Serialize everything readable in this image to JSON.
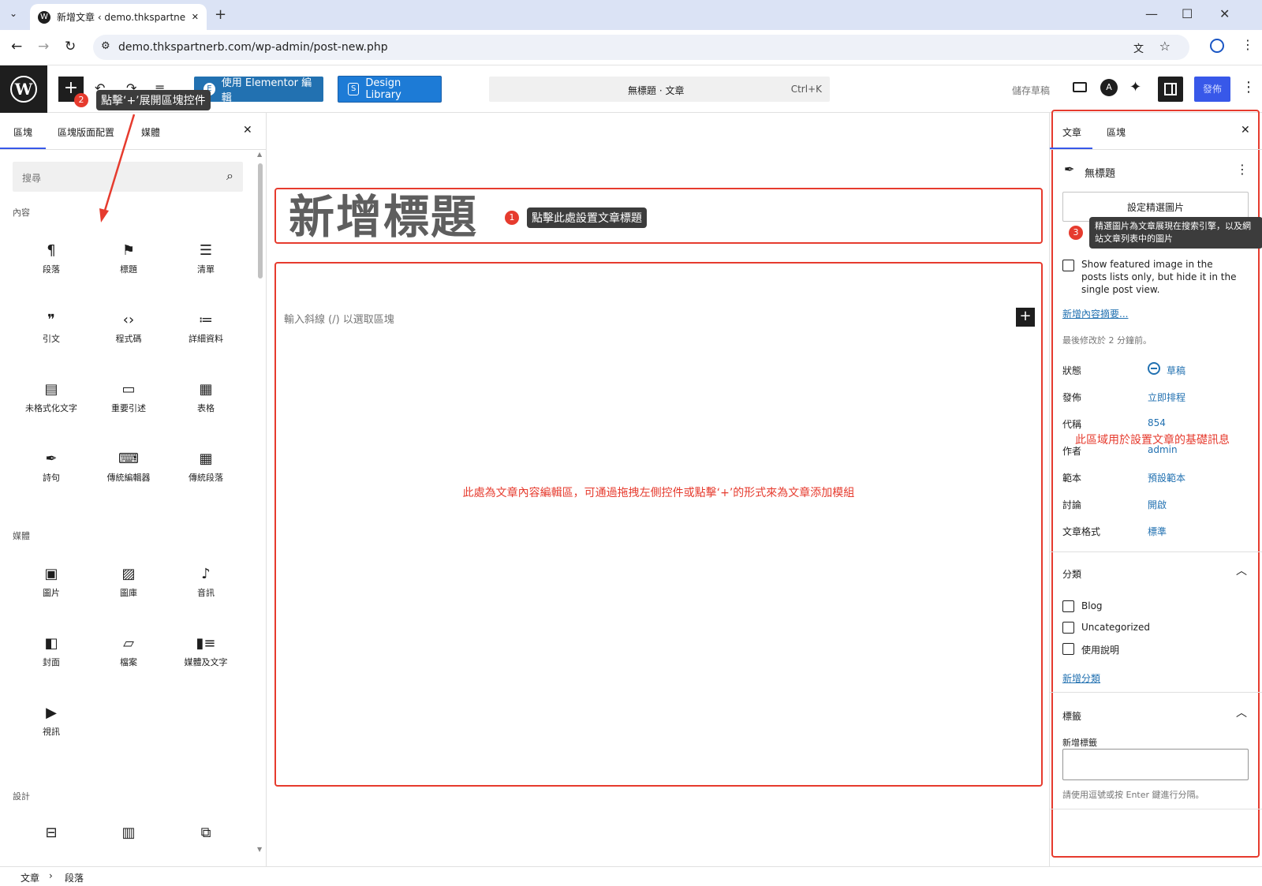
{
  "browser": {
    "tab_title": "新增文章 ‹ demo.thkspartnerb",
    "url": "demo.thkspartnerb.com/wp-admin/post-new.php",
    "new_tab": "+",
    "minimize": "—",
    "maximize": "☐",
    "close": "✕"
  },
  "toolbar": {
    "add_block": "+",
    "elementor_label": "使用 Elementor 編輯",
    "design_library_label": "Design Library",
    "command_title": "無標題 · 文章",
    "command_shortcut": "Ctrl+K",
    "save_draft": "儲存草稿",
    "publish": "發佈"
  },
  "inserter": {
    "tabs": [
      "區塊",
      "區塊版面配置",
      "媒體"
    ],
    "search_placeholder": "搜尋",
    "sections": [
      {
        "title": "內容",
        "blocks": [
          {
            "label": "段落",
            "icon": "¶"
          },
          {
            "label": "標題",
            "icon": "⚑"
          },
          {
            "label": "清單",
            "icon": "☰"
          },
          {
            "label": "引文",
            "icon": "❞"
          },
          {
            "label": "程式碼",
            "icon": "‹›"
          },
          {
            "label": "詳細資料",
            "icon": "≔"
          },
          {
            "label": "未格式化文字",
            "icon": "▤"
          },
          {
            "label": "重要引述",
            "icon": "▭"
          },
          {
            "label": "表格",
            "icon": "▦"
          },
          {
            "label": "詩句",
            "icon": "✒"
          },
          {
            "label": "傳統編輯器",
            "icon": "⌨"
          },
          {
            "label": "傳統段落",
            "icon": "▦"
          }
        ]
      },
      {
        "title": "媒體",
        "blocks": [
          {
            "label": "圖片",
            "icon": "▣"
          },
          {
            "label": "圖庫",
            "icon": "▨"
          },
          {
            "label": "音訊",
            "icon": "♪"
          },
          {
            "label": "封面",
            "icon": "◧"
          },
          {
            "label": "檔案",
            "icon": "▱"
          },
          {
            "label": "媒體及文字",
            "icon": "▮≡"
          },
          {
            "label": "視訊",
            "icon": "▶"
          }
        ]
      },
      {
        "title": "設計",
        "blocks": [
          {
            "label": "",
            "icon": "⊟"
          },
          {
            "label": "",
            "icon": "▥"
          },
          {
            "label": "",
            "icon": "⧉"
          }
        ]
      }
    ]
  },
  "editor": {
    "title_placeholder": "新增標題",
    "body_placeholder": "輸入斜線 (/) 以選取區塊",
    "annotation_title": "點擊此處設置文章標題",
    "annotation_body": "此處為文章內容編輯區，可通過拖拽左側控件或點擊‘+’的形式來為文章添加模組",
    "annotation_inserter": "點擊‘+’展開區塊控件",
    "marker_1": "1",
    "marker_2": "2",
    "marker_3": "3"
  },
  "settings": {
    "tabs": [
      "文章",
      "區塊"
    ],
    "post_title": "無標題",
    "featured_button": "設定精選圖片",
    "featured_tooltip": "精選圖片為文章展現在搜索引擎，以及網站文章列表中的圖片",
    "featured_checkbox": "Show featured image in the posts lists only, but hide it in the single post view.",
    "add_excerpt": "新增內容摘要...",
    "last_modified": "最後修改於 2 分鐘前。",
    "rows": [
      {
        "label": "狀態",
        "value": "草稿"
      },
      {
        "label": "發佈",
        "value": "立即排程"
      },
      {
        "label": "代稱",
        "value": "854"
      },
      {
        "label": "作者",
        "value": "admin"
      },
      {
        "label": "範本",
        "value": "預設範本"
      },
      {
        "label": "討論",
        "value": "開啟"
      },
      {
        "label": "文章格式",
        "value": "標準"
      }
    ],
    "annotation_settings": "此區域用於設置文章的基礎訊息",
    "categories_title": "分類",
    "categories": [
      "Blog",
      "Uncategorized",
      "使用說明"
    ],
    "add_category": "新增分類",
    "tags_title": "標籤",
    "tags_label": "新增標籤",
    "tags_hint": "請使用逗號或按 Enter 鍵進行分隔。"
  },
  "breadcrumb": [
    "文章",
    "段落"
  ],
  "colors": {
    "accent": "#3858e9",
    "wp_blue": "#2271b1",
    "annotation_red": "#e63b2e"
  }
}
